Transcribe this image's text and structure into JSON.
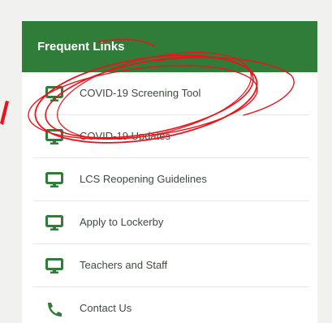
{
  "panel": {
    "title": "Frequent Links",
    "header_color": "#2f7d38",
    "accent_icon_color": "#2f7d38"
  },
  "links": [
    {
      "label": "COVID-19 Screening Tool",
      "icon": "monitor-icon"
    },
    {
      "label": "COVID-19 Updates",
      "icon": "monitor-icon"
    },
    {
      "label": "LCS Reopening Guidelines",
      "icon": "monitor-icon"
    },
    {
      "label": "Apply to Lockerby",
      "icon": "monitor-icon"
    },
    {
      "label": "Teachers and Staff",
      "icon": "monitor-icon"
    },
    {
      "label": "Contact Us",
      "icon": "phone-icon"
    }
  ],
  "annotation": {
    "color": "#e8141c",
    "target": "COVID-19 Screening Tool"
  }
}
